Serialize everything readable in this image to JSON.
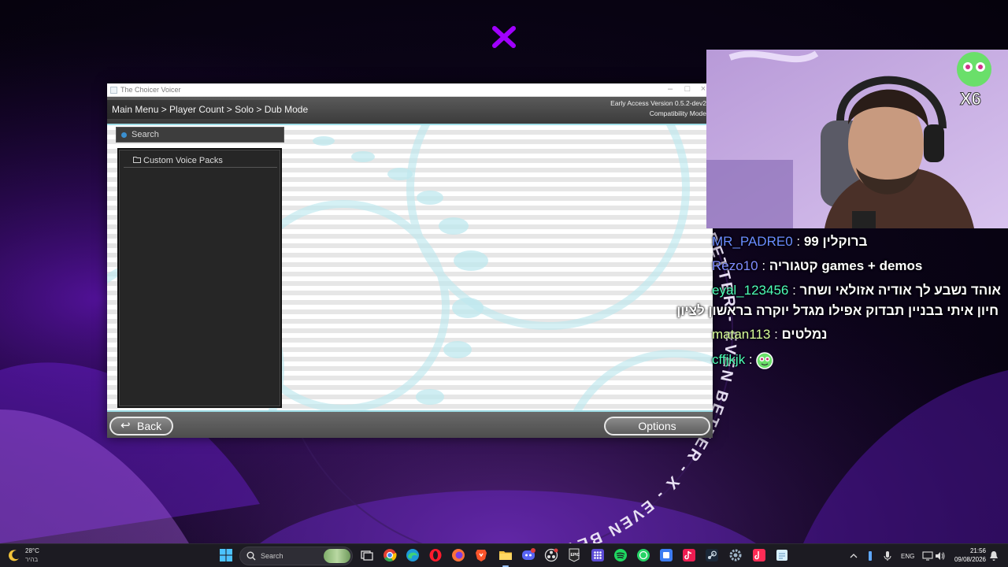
{
  "window": {
    "title": "The Choicer Voicer",
    "breadcrumb": "Main Menu > Player Count > Solo > Dub Mode",
    "version": "Early Access Version 0.5.2-dev2",
    "mode": "Compatibility Mode",
    "search_placeholder": "Search",
    "folders": [
      {
        "label": "Custom Voice Packs",
        "icon": "folder-icon"
      }
    ],
    "back_label": "Back",
    "options_label": "Options",
    "accent_color": "#9fdde6"
  },
  "wallpaper": {
    "ring_text": "EVEN BETTER - X - EVEN BETTER - ",
    "accent_color": "#a000ff"
  },
  "webcam": {
    "badge": "X6"
  },
  "chat": [
    {
      "user": "MR_PADRE0",
      "color": "#6a8cff",
      "sep": " : ",
      "message": "ברוקלין 99"
    },
    {
      "user": "Rezo10",
      "color": "#7f8cff",
      "sep": " : ",
      "message": "קטגוריה games + demos"
    },
    {
      "user": "eyal_123456",
      "color": "#4dffb8",
      "sep": " : ",
      "message": "אוהד נשבע לך אודיה אזולאי ושחר"
    },
    {
      "user": "",
      "color": "#ffffff",
      "sep": "",
      "message": "חיון איתי בבניין תבדוק אפילו מגדל יוקרה בראשון לציון"
    },
    {
      "user": "matan113",
      "color": "#d8ff9a",
      "sep": " : ",
      "message": "נמלטים"
    },
    {
      "user": "cffjkjk",
      "color": "#4dffb8",
      "sep": " : ",
      "message": ""
    }
  ],
  "taskbar": {
    "weather_temp": "28°C",
    "weather_desc": "בהיר",
    "search_placeholder": "Search",
    "language": "ENG",
    "time": "21:56",
    "date": "09/08/2026",
    "icons": [
      "start-icon",
      "task-view-icon",
      "chrome-icon",
      "edge-icon",
      "opera-icon",
      "firefox-icon",
      "brave-icon",
      "file-explorer-icon",
      "discord-icon",
      "obs-icon",
      "epic-games-icon",
      "app-grid-icon",
      "spotify-icon",
      "whatsapp-icon",
      "app-icon",
      "tiktok-icon",
      "steam-icon",
      "settings-icon",
      "tiktok-live-icon",
      "notepad-icon"
    ]
  }
}
